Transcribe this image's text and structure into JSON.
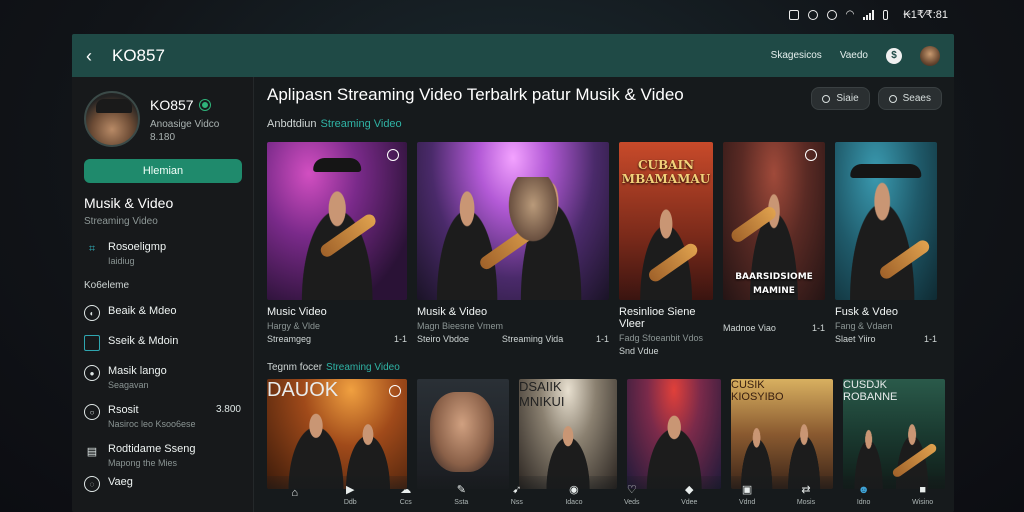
{
  "status": {
    "time": "₭1₹⁄₹:81",
    "icons": [
      "settings-icon",
      "search-icon",
      "location-icon",
      "wifi-icon",
      "signal-icon",
      "battery-icon"
    ]
  },
  "app": {
    "title": "KO857",
    "top_links": [
      "Skagesicos",
      "Vaedo"
    ],
    "top_icon": "$"
  },
  "sidebar": {
    "profile": {
      "name": "KO857",
      "sub1": "Anoasige Vidco",
      "sub2": "8.180"
    },
    "primary_button": "Hlemian",
    "section_title": "Musik & Video",
    "section_sub": "Streaming Video",
    "item_featured": {
      "title": "Rosoeligmp",
      "sub": "Iaidiug"
    },
    "label": "Ko6eleme",
    "items": [
      {
        "title": "Beaik & Mdeo",
        "sub": ""
      },
      {
        "title": "Sseik & Mdoin",
        "sub": ""
      },
      {
        "title": "Masik lango",
        "sub": "Seagavan"
      },
      {
        "title": "Rsosit",
        "sub": "Nasiroc leo Ksoo6ese",
        "trail": "3.800"
      },
      {
        "title": "Rodtidame Sseng",
        "sub": "Mapong the Mies"
      },
      {
        "title": "Vaeg",
        "sub": ""
      }
    ]
  },
  "main": {
    "title": "Aplipasn Streaming  Video Terbalrk patur Musik & Video",
    "pills": [
      "Siaie",
      "Seaes"
    ],
    "crumb": {
      "prefix": "Anbdtdiun",
      "link": "Streaming Video"
    },
    "row1": [
      {
        "title": "Music Video",
        "sub": "Hargy & Vlde",
        "left": "Streamgeg",
        "right": "1-1"
      },
      {
        "title": "Musik & Video",
        "sub": "Magn Bieesne Vmem",
        "left": "Steiro Vbdoe",
        "mid": "Streaming Vida",
        "right": "1-1"
      },
      {
        "title": "Resinlioe Siene Vleer",
        "sub": "Fadg Sfoeanbit Vdos",
        "left": "Snd Vdue",
        "mid": "Madnoe Viao",
        "right": "1-1"
      },
      {
        "title": "Fusk & Vdeo",
        "sub": "Fang & Vdaen",
        "left": "Slaet Yiiro",
        "right": "1-1"
      }
    ],
    "row1_overlay": [
      "CUBAIN\nMBAMAMAU",
      "BAARSIDSIOME\nMAMINE"
    ],
    "section2": {
      "prefix": "Tegnm focer",
      "link": "Streaming Video"
    },
    "row2_overlay": [
      "DAUOK",
      "DSAIIK\nMNIKUI",
      "CUSIK\nKIOSYIBO",
      "CUSDJK\nROBANNE"
    ]
  },
  "nav": [
    {
      "icon": "home-icon",
      "label": ""
    },
    {
      "icon": "play-icon",
      "label": "Ddb"
    },
    {
      "icon": "cloud-icon",
      "label": "Ccs"
    },
    {
      "icon": "edit-icon",
      "label": "Ssta"
    },
    {
      "icon": "fire-icon",
      "label": "Nss"
    },
    {
      "icon": "video-icon",
      "label": "Idaco"
    },
    {
      "icon": "heart-icon",
      "label": "Veds"
    },
    {
      "icon": "drop-icon",
      "label": "Vdee"
    },
    {
      "icon": "box-icon",
      "label": "Vdnd"
    },
    {
      "icon": "swap-icon",
      "label": "Mosis"
    },
    {
      "icon": "person-icon",
      "label": "Idno"
    },
    {
      "icon": "square-icon",
      "label": "Wisino"
    }
  ],
  "colors": {
    "topbar": "#1f4a46",
    "accent": "#1f8a6c",
    "link": "#2fb3a5"
  }
}
